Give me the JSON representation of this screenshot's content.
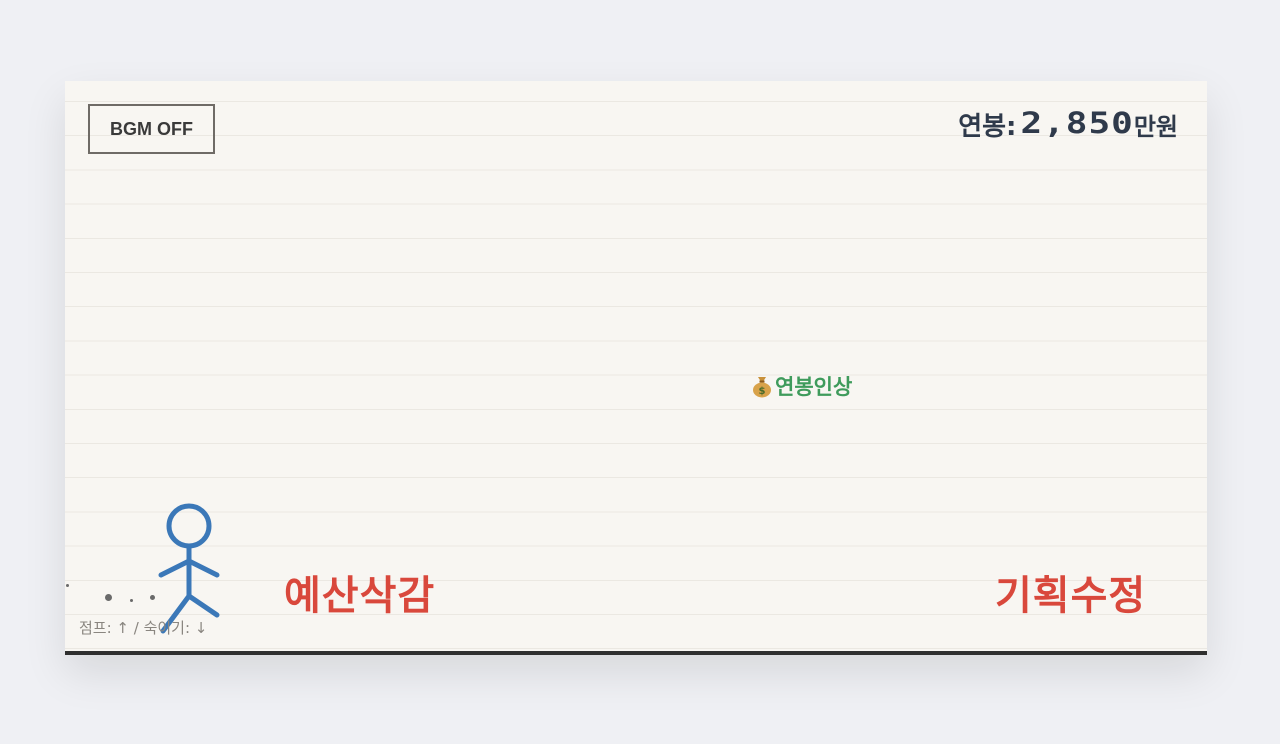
{
  "bgm_button": {
    "label": "BGM OFF"
  },
  "salary": {
    "label": "연봉:",
    "value": "2,850",
    "unit": "만원"
  },
  "powerup": {
    "icon": "money-bag-icon",
    "label": "연봉인상"
  },
  "obstacles": [
    {
      "label": "예산삭감"
    },
    {
      "label": "기획수정"
    }
  ],
  "controls_hint": "점프: ↑ / 숙이기: ↓",
  "colors": {
    "salary": "#2f3a4b",
    "powerup": "#3f9b5c",
    "obstacle": "#d9483c",
    "player": "#3b78b8"
  }
}
